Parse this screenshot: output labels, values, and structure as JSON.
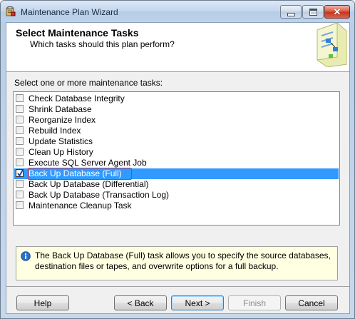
{
  "window": {
    "title": "Maintenance Plan Wizard"
  },
  "header": {
    "title": "Select Maintenance Tasks",
    "subtitle": "Which tasks should this plan perform?"
  },
  "instructions": "Select one or more maintenance tasks:",
  "tasks": [
    {
      "label": "Check Database Integrity",
      "checked": false,
      "selected": false
    },
    {
      "label": "Shrink Database",
      "checked": false,
      "selected": false
    },
    {
      "label": "Reorganize Index",
      "checked": false,
      "selected": false
    },
    {
      "label": "Rebuild Index",
      "checked": false,
      "selected": false
    },
    {
      "label": "Update Statistics",
      "checked": false,
      "selected": false
    },
    {
      "label": "Clean Up History",
      "checked": false,
      "selected": false
    },
    {
      "label": "Execute SQL Server Agent Job",
      "checked": false,
      "selected": false
    },
    {
      "label": "Back Up Database (Full)",
      "checked": true,
      "selected": true
    },
    {
      "label": "Back Up Database (Differential)",
      "checked": false,
      "selected": false
    },
    {
      "label": "Back Up Database (Transaction Log)",
      "checked": false,
      "selected": false
    },
    {
      "label": "Maintenance Cleanup Task",
      "checked": false,
      "selected": false
    }
  ],
  "description": "The Back Up Database (Full) task allows you to specify the source databases, destination files or tapes, and overwrite options for a full backup.",
  "buttons": {
    "help": "Help",
    "back": "< Back",
    "next": "Next >",
    "finish": "Finish",
    "cancel": "Cancel"
  },
  "colors": {
    "selection": "#3399ff",
    "info_background": "#ffffe1",
    "close_button": "#c3341c"
  },
  "icons": {
    "app": "wizard-app-icon",
    "minimize": "minimize-icon",
    "maximize": "maximize-icon",
    "close": "close-icon",
    "header": "maintenance-plan-graphic",
    "info": "info-icon",
    "check": "checkmark-icon"
  }
}
